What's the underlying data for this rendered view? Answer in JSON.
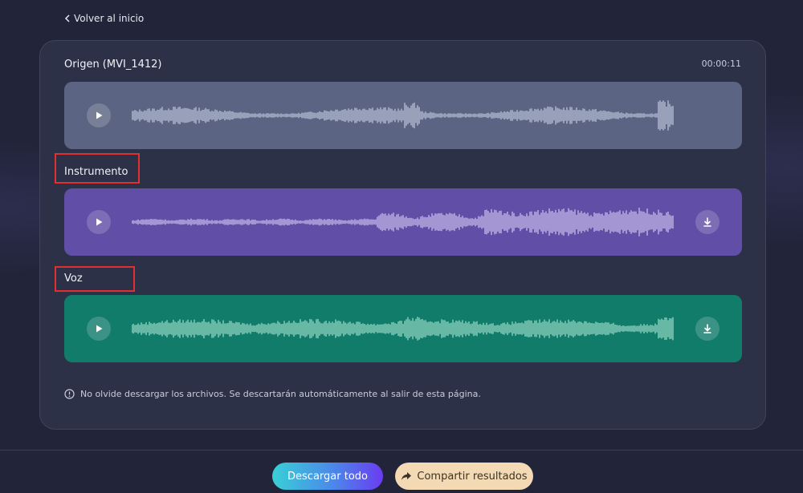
{
  "nav": {
    "back_label": "Volver al inicio"
  },
  "panel": {
    "duration": "00:00:11",
    "tracks": [
      {
        "label": "Origen (MVI_1412)",
        "color": "#5b6482",
        "wave_color": "#a9b0c8",
        "downloadable": false
      },
      {
        "label": "Instrumento",
        "color": "#604ea7",
        "wave_color": "#b4a8dd",
        "downloadable": true
      },
      {
        "label": "Voz",
        "color": "#127c6b",
        "wave_color": "#7ec7b6",
        "downloadable": true
      }
    ],
    "notice": "No olvide descargar los archivos. Se descartarán automáticamente al salir de esta página."
  },
  "footer": {
    "download_all_label": "Descargar todo",
    "share_label": "Compartir resultados"
  },
  "icons": {
    "back": "chevron-left-icon",
    "play": "play-icon",
    "download": "download-icon",
    "info": "info-icon",
    "share": "share-arrow-icon"
  },
  "colors": {
    "page_bg": "#22243a",
    "panel_bg": "#2d3147",
    "highlight": "#e03030",
    "primary_gradient": [
      "#39d0d6",
      "#4b88ea",
      "#6a3cf0"
    ],
    "secondary_bg": "#f3d9b4"
  }
}
